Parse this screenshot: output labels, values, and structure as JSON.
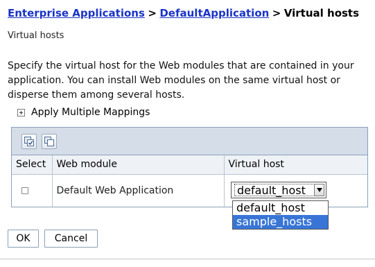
{
  "breadcrumb": {
    "items": [
      {
        "label": "Enterprise Applications"
      },
      {
        "label": "DefaultApplication"
      }
    ],
    "separator": ">",
    "current": "Virtual hosts"
  },
  "page": {
    "subtitle": "Virtual hosts",
    "description": "Specify the virtual host for the Web modules that are contained in your application. You can install Web modules on the same virtual host or disperse them among several hosts."
  },
  "apply_mappings": {
    "label": "Apply Multiple Mappings",
    "icon": "plus-box-icon"
  },
  "toolbar": {
    "icons": [
      "select-all-icon",
      "deselect-all-icon"
    ]
  },
  "table": {
    "columns": [
      "Select",
      "Web module",
      "Virtual host"
    ],
    "rows": [
      {
        "select_checked": false,
        "module": "Default Web Application",
        "virtual_host": "default_host"
      }
    ]
  },
  "virtual_host_dropdown": {
    "selected": "default_host",
    "options": [
      "default_host",
      "sample_hosts"
    ],
    "highlighted": "sample_hosts"
  },
  "buttons": {
    "ok": "OK",
    "cancel": "Cancel"
  },
  "colors": {
    "link": "#1a33c8",
    "toolbar_bg": "#d4dde8",
    "header_bg": "#eef2f6",
    "highlight": "#3875d7"
  }
}
